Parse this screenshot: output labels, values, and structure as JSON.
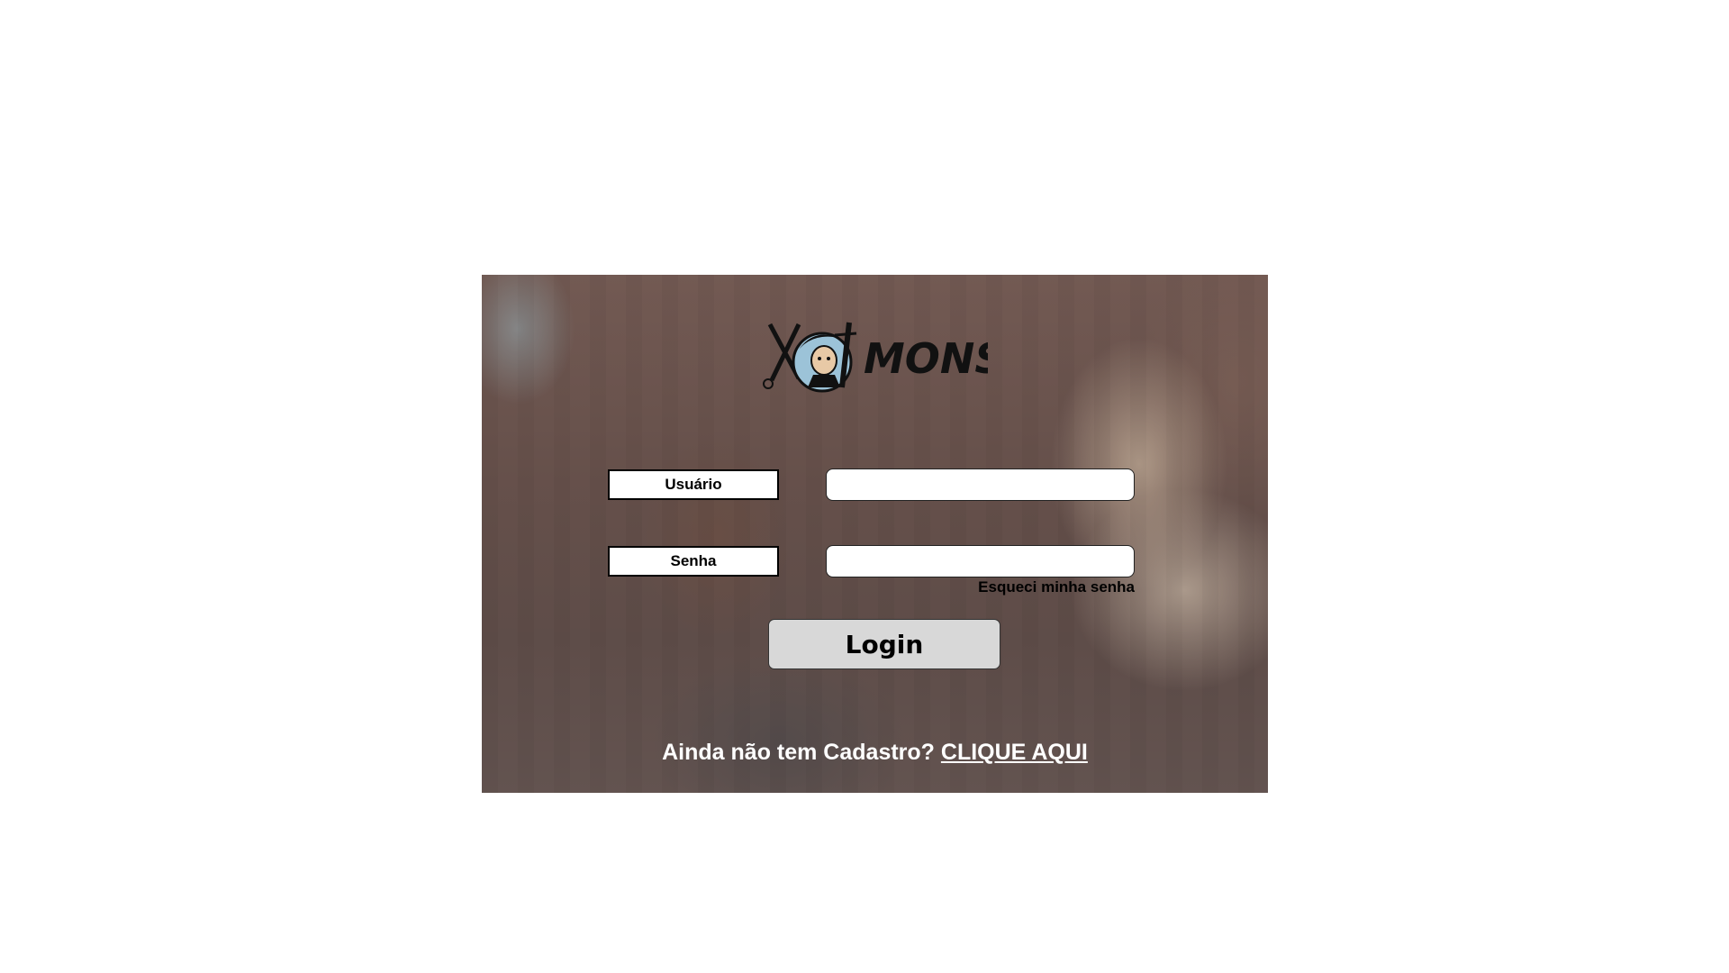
{
  "login": {
    "logo_text": "MONS",
    "username_label": "Usuário",
    "username_value": "",
    "password_label": "Senha",
    "password_value": "",
    "forgot_password": "Esqueci minha senha",
    "login_button": "Login",
    "signup_prompt": "Ainda não tem Cadastro?",
    "signup_link": "CLIQUE AQUI"
  }
}
